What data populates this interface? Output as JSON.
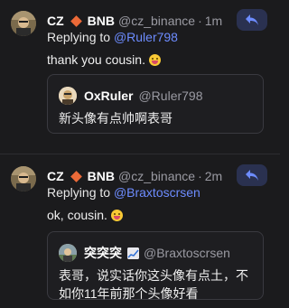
{
  "posts": [
    {
      "author": {
        "name": "CZ",
        "ticker": "BNB",
        "handle": "@cz_binance",
        "time": "1m"
      },
      "replying_prefix": "Replying to",
      "replying_to": "@Ruler798",
      "text": "thank you cousin.",
      "emoji": "grinning-tongue-emoji",
      "quote": {
        "name": "OxRuler",
        "handle": "@Ruler798",
        "text": "新头像有点帅啊表哥"
      }
    },
    {
      "author": {
        "name": "CZ",
        "ticker": "BNB",
        "handle": "@cz_binance",
        "time": "2m"
      },
      "replying_prefix": "Replying to",
      "replying_to": "@Braxtoscrsen",
      "text": "ok, cousin.",
      "emoji": "grinning-tongue-emoji",
      "quote": {
        "name": "突突突",
        "handle": "@Braxtoscrsen",
        "text": "表哥，说实话你这头像有点土，不如你11年前那个头像好看"
      }
    }
  ],
  "colors": {
    "background": "#1b1b1d",
    "accent_diamond": "#ec6a38",
    "mention": "#6d8cff",
    "reply_button_bg": "#2a3150"
  },
  "separator": "·"
}
